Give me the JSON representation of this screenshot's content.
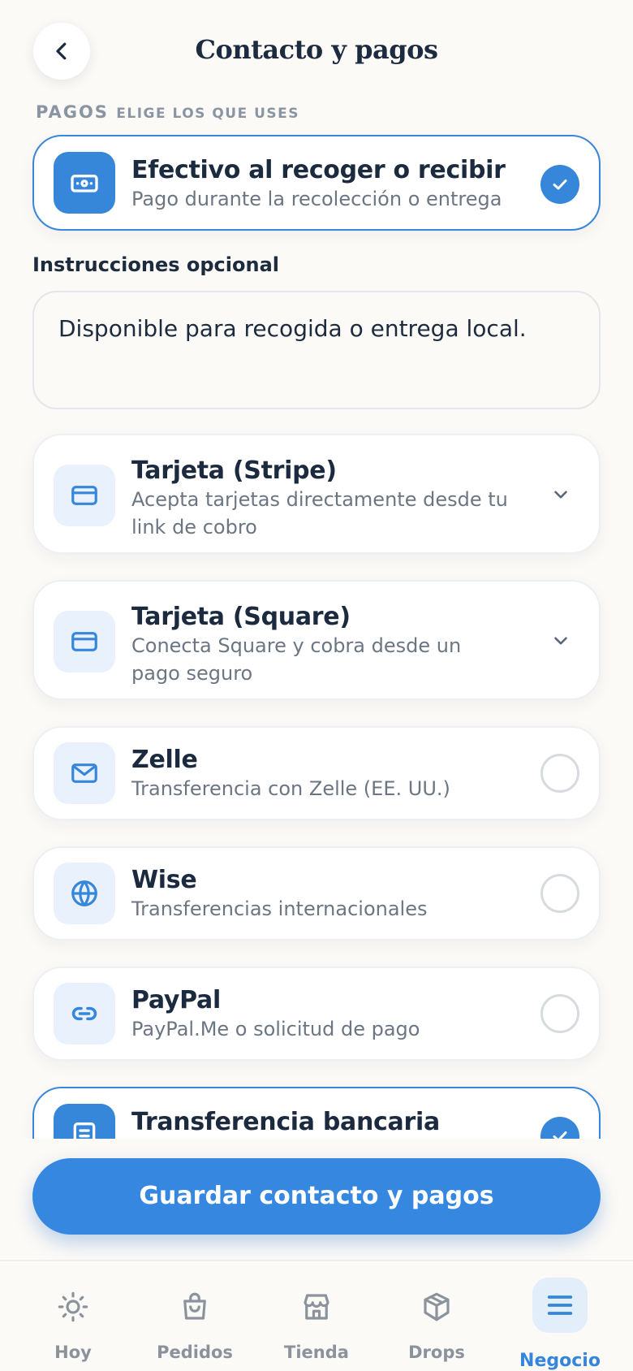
{
  "header": {
    "title": "Contacto y pagos",
    "back_icon": "chevron-left-icon"
  },
  "payments_section": {
    "label": "PAGOS",
    "sublabel": "ELIGE LOS QUE USES"
  },
  "methods": [
    {
      "id": "cash",
      "title": "Efectivo al recoger o recibir",
      "subtitle": "Pago durante la recolección o entrega",
      "icon": "cash-icon",
      "state": "selected"
    },
    {
      "id": "stripe",
      "title": "Tarjeta (Stripe)",
      "subtitle": "Acepta tarjetas directamente desde tu link de cobro",
      "icon": "credit-card-icon",
      "state": "expandable"
    },
    {
      "id": "square",
      "title": "Tarjeta (Square)",
      "subtitle": "Conecta Square y cobra desde un pago seguro",
      "icon": "credit-card-icon",
      "state": "expandable"
    },
    {
      "id": "zelle",
      "title": "Zelle",
      "subtitle": "Transferencia con Zelle (EE. UU.)",
      "icon": "mail-icon",
      "state": "unselected"
    },
    {
      "id": "wise",
      "title": "Wise",
      "subtitle": "Transferencias internacionales",
      "icon": "globe-icon",
      "state": "unselected"
    },
    {
      "id": "paypal",
      "title": "PayPal",
      "subtitle": "PayPal.Me o solicitud de pago",
      "icon": "link-icon",
      "state": "unselected"
    },
    {
      "id": "bank",
      "title": "Transferencia bancaria",
      "subtitle": "",
      "icon": "bank-icon",
      "state": "selected"
    }
  ],
  "instructions": {
    "label": "Instrucciones opcional",
    "value": "Disponible para recogida o entrega local."
  },
  "save_button": {
    "label": "Guardar contacto y pagos"
  },
  "tabbar": {
    "items": [
      {
        "label": "Hoy",
        "icon": "sun-icon",
        "active": false
      },
      {
        "label": "Pedidos",
        "icon": "shopping-bag-icon",
        "active": false
      },
      {
        "label": "Tienda",
        "icon": "store-icon",
        "active": false
      },
      {
        "label": "Drops",
        "icon": "box-icon",
        "active": false
      },
      {
        "label": "Negocio",
        "icon": "menu-icon",
        "active": true
      }
    ]
  },
  "colors": {
    "accent": "#3686da",
    "background": "#fcfaf7",
    "text": "#1d2b3e",
    "muted": "#6c7683"
  }
}
